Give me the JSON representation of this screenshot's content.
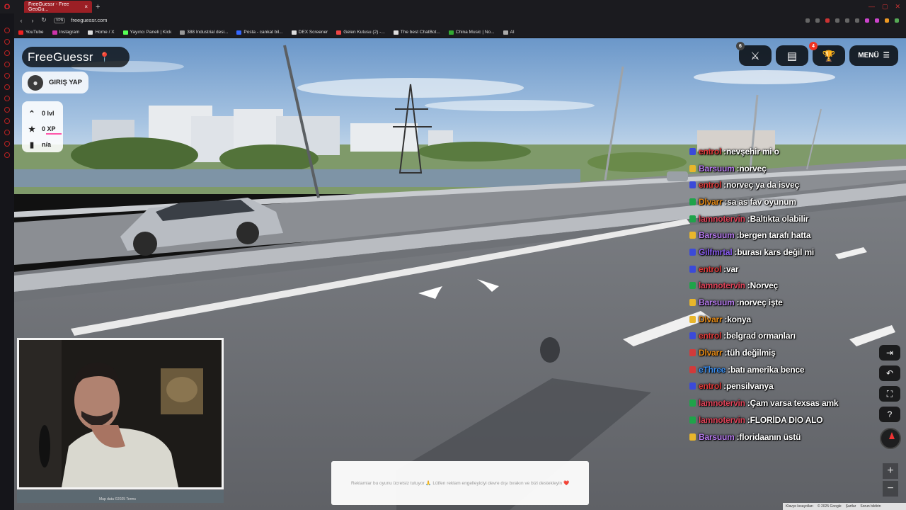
{
  "browser": {
    "tab_title": "FreeGuessr - Free GeoGu...",
    "url": "freeguessr.com",
    "vpn_label": "VPN",
    "bookmarks": [
      {
        "label": "YouTube",
        "color": "#e22"
      },
      {
        "label": "Instagram",
        "color": "#c3a"
      },
      {
        "label": "Home / X",
        "color": "#ddd"
      },
      {
        "label": "Yayıncı Paneli | Kick",
        "color": "#5f5"
      },
      {
        "label": "388 Industrial desi...",
        "color": "#999"
      },
      {
        "label": "Posta - cankat bil...",
        "color": "#36f"
      },
      {
        "label": "DEX Screener",
        "color": "#ddd"
      },
      {
        "label": "Gelen Kutusu (2) -...",
        "color": "#e44"
      },
      {
        "label": "The best ChatBot...",
        "color": "#ddd"
      },
      {
        "label": "China Music | No...",
        "color": "#3a3"
      },
      {
        "label": "AI",
        "color": "#aaa"
      }
    ]
  },
  "game": {
    "logo_text": "FreeGuessr",
    "login_label": "GIRIŞ YAP",
    "stats": {
      "level": "0 lvl",
      "xp": "0 XP",
      "rank": "n/a"
    },
    "badges": {
      "battle": "6",
      "shop": "4"
    },
    "menu_label": "MENÜ",
    "ad_text": "Reklamlar bu oyunu ücretsiz tutuyor 🙏 Lütfen reklam engelleyiciyi devre dışı bırakın ve bizi destekleyin ❤️",
    "footer": {
      "shortcuts": "Klavye kısayolları",
      "copyright": "© 2025 Google",
      "terms": "Şartlar",
      "report": "Sorun bildirin"
    },
    "map_data": "Map data ©2025   Terms"
  },
  "chat": [
    {
      "user": "entrol",
      "text": "nevşehir mi o",
      "color": "#e03a3a",
      "badge": "#3b4ad8"
    },
    {
      "user": "Barsuum",
      "text": "norveç",
      "color": "#b87cf0",
      "badge": "#e8b62b"
    },
    {
      "user": "entrol",
      "text": "norveç ya da isveç",
      "color": "#e03a3a",
      "badge": "#3b4ad8"
    },
    {
      "user": "Dlvarr",
      "text": "sa as fav oyunum",
      "color": "#e58a17",
      "badge": "#1fa34a"
    },
    {
      "user": "lamnotervin",
      "text": "Baltıkta olabilir",
      "color": "#e0445a",
      "badge": "#1fa34a"
    },
    {
      "user": "Barsuum",
      "text": "bergen tarafı hatta",
      "color": "#b87cf0",
      "badge": "#e8b62b"
    },
    {
      "user": "Gilfmrtal",
      "text": "burası kars değil mi",
      "color": "#8a5cf0",
      "badge": "#3b4ad8"
    },
    {
      "user": "entrol",
      "text": "var",
      "color": "#e03a3a",
      "badge": "#3b4ad8"
    },
    {
      "user": "lamnotervin",
      "text": "Norveç",
      "color": "#e0445a",
      "badge": "#1fa34a"
    },
    {
      "user": "Barsuum",
      "text": "norveç işte",
      "color": "#b87cf0",
      "badge": "#e8b62b"
    },
    {
      "user": "Dlvarr",
      "text": "konya",
      "color": "#e58a17",
      "badge": "#e8b62b"
    },
    {
      "user": "entrol",
      "text": "belgrad ormanları",
      "color": "#e03a3a",
      "badge": "#3b4ad8"
    },
    {
      "user": "Dlvarr",
      "text": "tüh değilmiş",
      "color": "#e58a17",
      "badge": "#d23a3a"
    },
    {
      "user": "eThree",
      "text": "batı amerika bence",
      "color": "#3a8ef0",
      "badge": "#d23a3a"
    },
    {
      "user": "entrol",
      "text": "pensilvanya",
      "color": "#e03a3a",
      "badge": "#3b4ad8"
    },
    {
      "user": "lamnotervin",
      "text": "Çam varsa texsas amk",
      "color": "#e0445a",
      "badge": "#1fa34a"
    },
    {
      "user": "lamnotervin",
      "text": "FLORİDA DIO ALO",
      "color": "#e0445a",
      "badge": "#1fa34a"
    },
    {
      "user": "Barsuum",
      "text": "floridaanın üstü",
      "color": "#b87cf0",
      "badge": "#e8b62b"
    }
  ]
}
